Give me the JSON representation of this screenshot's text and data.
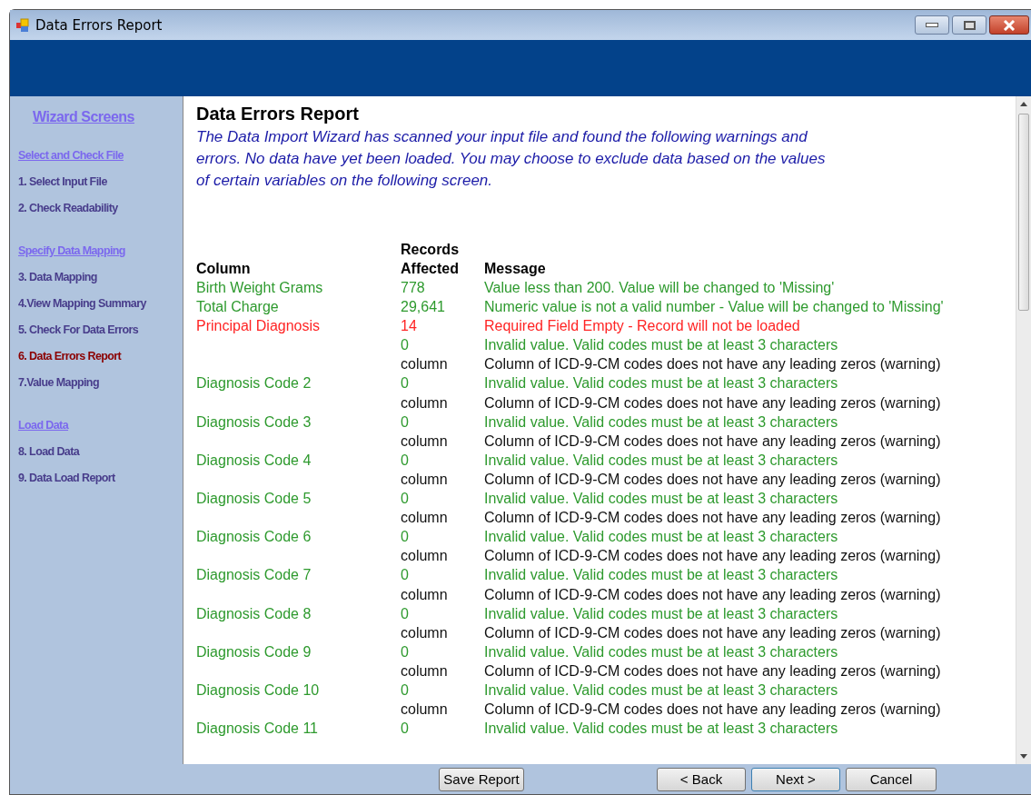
{
  "window": {
    "title": "Data Errors Report"
  },
  "sidebar": {
    "title": "Wizard Screens",
    "items": [
      {
        "kind": "heading",
        "label": "Select and Check File"
      },
      {
        "kind": "step",
        "label": "1. Select Input File",
        "selected": false
      },
      {
        "kind": "step",
        "label": "2. Check Readability",
        "selected": false
      },
      {
        "kind": "heading",
        "label": "Specify Data Mapping"
      },
      {
        "kind": "step",
        "label": "3. Data Mapping",
        "selected": false
      },
      {
        "kind": "step",
        "label": "4.View Mapping Summary",
        "selected": false
      },
      {
        "kind": "step",
        "label": "5. Check For Data Errors",
        "selected": false
      },
      {
        "kind": "step",
        "label": "6. Data Errors Report",
        "selected": true
      },
      {
        "kind": "step",
        "label": "7.Value Mapping",
        "selected": false
      },
      {
        "kind": "heading",
        "label": "Load Data"
      },
      {
        "kind": "step",
        "label": "8. Load Data",
        "selected": false
      },
      {
        "kind": "step",
        "label": "9. Data Load Report",
        "selected": false
      }
    ]
  },
  "content": {
    "title": "Data Errors Report",
    "intro": "The Data Import Wizard has scanned your input file and found the following warnings and errors. No data have yet been loaded. You may choose to exclude data based on the values of certain variables on the following screen.",
    "table": {
      "columns": [
        "Column",
        "Records Affected",
        "Message"
      ],
      "rows": [
        {
          "kind": "warning",
          "column": "Birth Weight Grams",
          "affected": "778",
          "message": "Value less than 200.  Value will be changed to 'Missing'"
        },
        {
          "kind": "warning",
          "column": "Total Charge",
          "affected": "29,641",
          "message": "Numeric value is not a valid number - Value will be changed to 'Missing'"
        },
        {
          "kind": "error",
          "column": "Principal Diagnosis",
          "affected": "14",
          "message": "Required Field Empty - Record will not be loaded"
        },
        {
          "kind": "warning",
          "affected": "0",
          "message": "Invalid value.  Valid codes must be at least 3 characters"
        },
        {
          "kind": "note",
          "affected": "column",
          "message": "Column of ICD-9-CM codes does not have any leading zeros (warning)"
        },
        {
          "kind": "warning",
          "column": "Diagnosis Code 2",
          "affected": "0",
          "message": "Invalid value.  Valid codes must be at least 3 characters"
        },
        {
          "kind": "note",
          "affected": "column",
          "message": "Column of ICD-9-CM codes does not have any leading zeros (warning)"
        },
        {
          "kind": "warning",
          "column": "Diagnosis Code 3",
          "affected": "0",
          "message": "Invalid value.  Valid codes must be at least 3 characters"
        },
        {
          "kind": "note",
          "affected": "column",
          "message": "Column of ICD-9-CM codes does not have any leading zeros (warning)"
        },
        {
          "kind": "warning",
          "column": "Diagnosis Code 4",
          "affected": "0",
          "message": "Invalid value.  Valid codes must be at least 3 characters"
        },
        {
          "kind": "note",
          "affected": "column",
          "message": "Column of ICD-9-CM codes does not have any leading zeros (warning)"
        },
        {
          "kind": "warning",
          "column": "Diagnosis Code 5",
          "affected": "0",
          "message": "Invalid value.  Valid codes must be at least 3 characters"
        },
        {
          "kind": "note",
          "affected": "column",
          "message": "Column of ICD-9-CM codes does not have any leading zeros (warning)"
        },
        {
          "kind": "warning",
          "column": "Diagnosis Code 6",
          "affected": "0",
          "message": "Invalid value.  Valid codes must be at least 3 characters"
        },
        {
          "kind": "note",
          "affected": "column",
          "message": "Column of ICD-9-CM codes does not have any leading zeros (warning)"
        },
        {
          "kind": "warning",
          "column": "Diagnosis Code 7",
          "affected": "0",
          "message": "Invalid value.  Valid codes must be at least 3 characters"
        },
        {
          "kind": "note",
          "affected": "column",
          "message": "Column of ICD-9-CM codes does not have any leading zeros (warning)"
        },
        {
          "kind": "warning",
          "column": "Diagnosis Code 8",
          "affected": "0",
          "message": "Invalid value.  Valid codes must be at least 3 characters"
        },
        {
          "kind": "note",
          "affected": "column",
          "message": "Column of ICD-9-CM codes does not have any leading zeros (warning)"
        },
        {
          "kind": "warning",
          "column": "Diagnosis Code 9",
          "affected": "0",
          "message": "Invalid value.  Valid codes must be at least 3 characters"
        },
        {
          "kind": "note",
          "affected": "column",
          "message": "Column of ICD-9-CM codes does not have any leading zeros (warning)"
        },
        {
          "kind": "warning",
          "column": "Diagnosis Code 10",
          "affected": "0",
          "message": "Invalid value.  Valid codes must be at least 3 characters"
        },
        {
          "kind": "note",
          "affected": "column",
          "message": "Column of ICD-9-CM codes does not have any leading zeros (warning)"
        },
        {
          "kind": "warning",
          "column": "Diagnosis Code 11",
          "affected": "0",
          "message": "Invalid value.  Valid codes must be at least 3 characters"
        }
      ]
    }
  },
  "buttons": [
    {
      "kind": "save",
      "label": "Save Report"
    },
    {
      "kind": "back",
      "label": "< Back"
    },
    {
      "kind": "next",
      "label": "Next >"
    },
    {
      "kind": "cancel",
      "label": "Cancel"
    }
  ]
}
